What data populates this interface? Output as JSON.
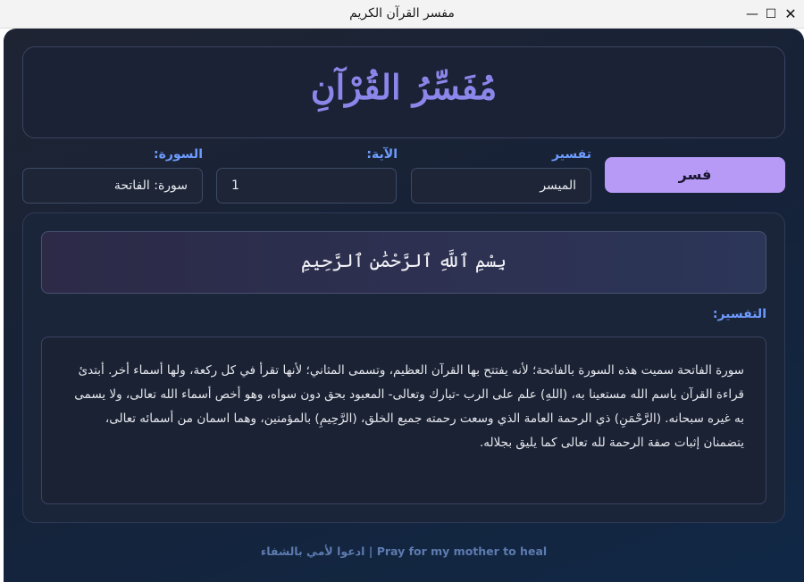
{
  "window": {
    "title": "مفسر القرآن الكريم",
    "controls": {
      "minimize_icon": "—",
      "maximize_icon": "☐",
      "close_icon": "✕"
    }
  },
  "header": {
    "brand": "مُفَسِّرُ القُرْآنِ"
  },
  "form": {
    "surah_label": "السورة:",
    "surah_value": "سورة: الفاتحة",
    "ayah_label": "الآية:",
    "ayah_value": "1",
    "tafsir_label": "تفسير",
    "tafsir_value": "الميسر",
    "submit_label": "فسر"
  },
  "verse": {
    "text": "بِسْمِ ٱللَّهِ ٱلرَّحْمَٰنِ ٱلرَّحِيمِ"
  },
  "tafsir": {
    "heading": "التفسير:",
    "body": "سورة الفاتحة سميت هذه السورة بالفاتحة؛ لأنه يفتتح بها القرآن العظيم، وتسمى المثاني؛ لأنها تقرأ في كل ركعة، ولها أسماء أخر. أبتدئ قراءة القرآن باسم الله مستعينا به، (اللهِ) علم على الرب -تبارك وتعالى- المعبود بحق دون سواه، وهو أخص أسماء الله تعالى، ولا يسمى به غيره سبحانه. (الرَّحْمَنِ) ذي الرحمة العامة الذي وسعت رحمته جميع الخلق، (الرَّحِيمِ) بالمؤمنين، وهما اسمان من أسمائه تعالى، يتضمنان إثبات صفة الرحمة لله تعالى كما يليق بجلاله."
  },
  "footer": {
    "text": "ادعوا لأمي بالشفاء | Pray for my mother to heal"
  },
  "colors": {
    "accent": "#b69af5",
    "brand": "#8b86ea",
    "label": "#6e9cff",
    "background": "#162238"
  }
}
